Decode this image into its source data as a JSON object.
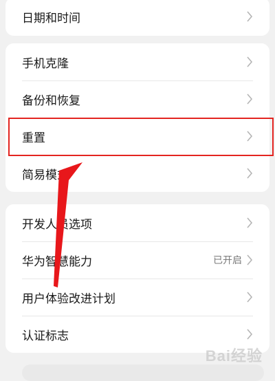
{
  "card1": {
    "items": [
      {
        "label": "日期和时间"
      }
    ]
  },
  "card2": {
    "items": [
      {
        "label": "手机克隆"
      },
      {
        "label": "备份和恢复"
      },
      {
        "label": "重置"
      },
      {
        "label": "简易模式"
      }
    ]
  },
  "card3": {
    "items": [
      {
        "label": "开发人员选项",
        "value": ""
      },
      {
        "label": "华为智慧能力",
        "value": "已开启"
      },
      {
        "label": "用户体验改进计划",
        "value": ""
      },
      {
        "label": "认证标志",
        "value": ""
      }
    ]
  },
  "annotation": {
    "highlight_color": "#e32420",
    "arrow_color": "#e8171b"
  },
  "watermark": {
    "text": "Bai经验"
  },
  "icons": {
    "chevron": "chevron-right-icon"
  }
}
